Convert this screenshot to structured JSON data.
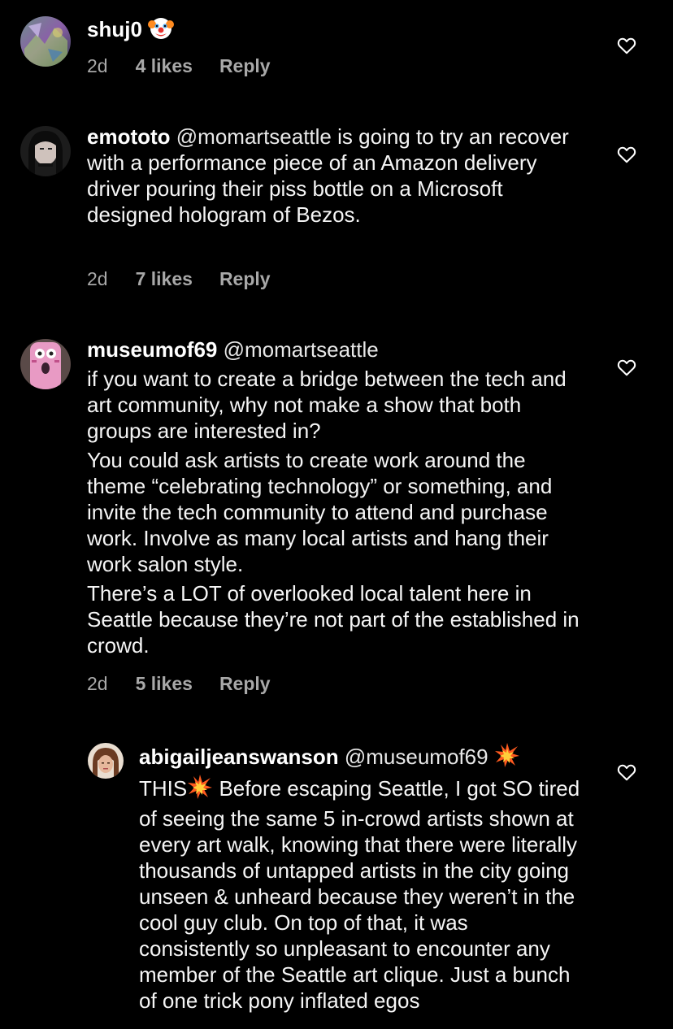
{
  "colors": {
    "background": "#000000",
    "text": "#ffffff",
    "meta": "#a8a8a8"
  },
  "comments": [
    {
      "username": "shuj0",
      "emoji": "clown-face",
      "text": "",
      "time": "2d",
      "likes": "4 likes",
      "reply": "Reply",
      "avatar": "avatar-shuj0"
    },
    {
      "username": "emototo",
      "mention": "@momartseattle",
      "text": " is going to try an recover with a performance piece of an Amazon delivery driver pouring their piss bottle on a Microsoft designed hologram of Bezos.",
      "time": "2d",
      "likes": "7 likes",
      "reply": "Reply",
      "avatar": "avatar-emototo"
    },
    {
      "username": "museumof69",
      "mention": "@momartseattle",
      "paragraphs": [
        "if you want to create a bridge between the tech and art community, why not make a show that both groups are interested in?",
        "You could ask artists to create work around the theme “celebrating technology” or something, and invite the tech community to attend and purchase work. Involve as many local artists and hang their work salon style.",
        "There’s a LOT of overlooked local talent here in Seattle because they’re not part of the established in crowd."
      ],
      "time": "2d",
      "likes": "5 likes",
      "reply": "Reply",
      "avatar": "avatar-museumof69"
    },
    {
      "username": "abigailjeanswanson",
      "mention": "@museumof69",
      "text_start": "THIS",
      "text": " Before escaping Seattle, I got SO tired of seeing the same 5 in-crowd artists shown at every art walk, knowing that there were literally thousands of untapped artists in the city going unseen & unheard because they weren’t in the cool guy club. On top of that, it was consistently so unpleasant to encounter any member of the Seattle art clique. Just a bunch of one trick pony inflated egos",
      "avatar": "avatar-abigailjeanswanson"
    }
  ]
}
